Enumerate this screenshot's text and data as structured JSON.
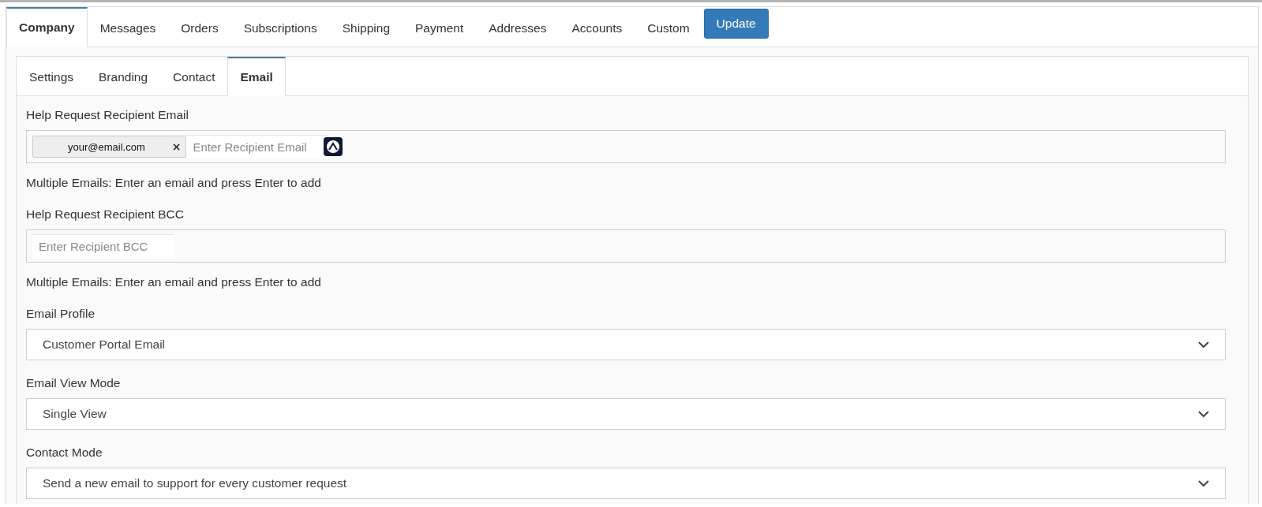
{
  "main_tabs": [
    {
      "label": "Company",
      "selected": true
    },
    {
      "label": "Messages",
      "selected": false
    },
    {
      "label": "Orders",
      "selected": false
    },
    {
      "label": "Subscriptions",
      "selected": false
    },
    {
      "label": "Shipping",
      "selected": false
    },
    {
      "label": "Payment",
      "selected": false
    },
    {
      "label": "Addresses",
      "selected": false
    },
    {
      "label": "Accounts",
      "selected": false
    },
    {
      "label": "Custom",
      "selected": false
    }
  ],
  "update_button": "Update",
  "sub_tabs": [
    {
      "label": "Settings",
      "selected": false
    },
    {
      "label": "Branding",
      "selected": false
    },
    {
      "label": "Contact",
      "selected": false
    },
    {
      "label": "Email",
      "selected": true
    }
  ],
  "fields": [
    {
      "kind": "tags",
      "label": "Help Request Recipient Email",
      "tags": [
        {
          "text": "your@email.com",
          "remove": "×"
        }
      ],
      "placeholder": "Enter Recipient Email",
      "help": "Multiple Emails: Enter an email and press Enter to add",
      "assist_icon": true
    },
    {
      "kind": "tags",
      "label": "Help Request Recipient BCC",
      "placeholder": "Enter Recipient BCC",
      "help": "Multiple Emails: Enter an email and press Enter to add"
    },
    {
      "kind": "select",
      "label": "Email Profile",
      "value": "Customer Portal Email"
    },
    {
      "kind": "select",
      "label": "Email View Mode",
      "value": "Single View"
    },
    {
      "kind": "select",
      "label": "Contact Mode",
      "value": "Send a new email to support for every customer request"
    }
  ]
}
